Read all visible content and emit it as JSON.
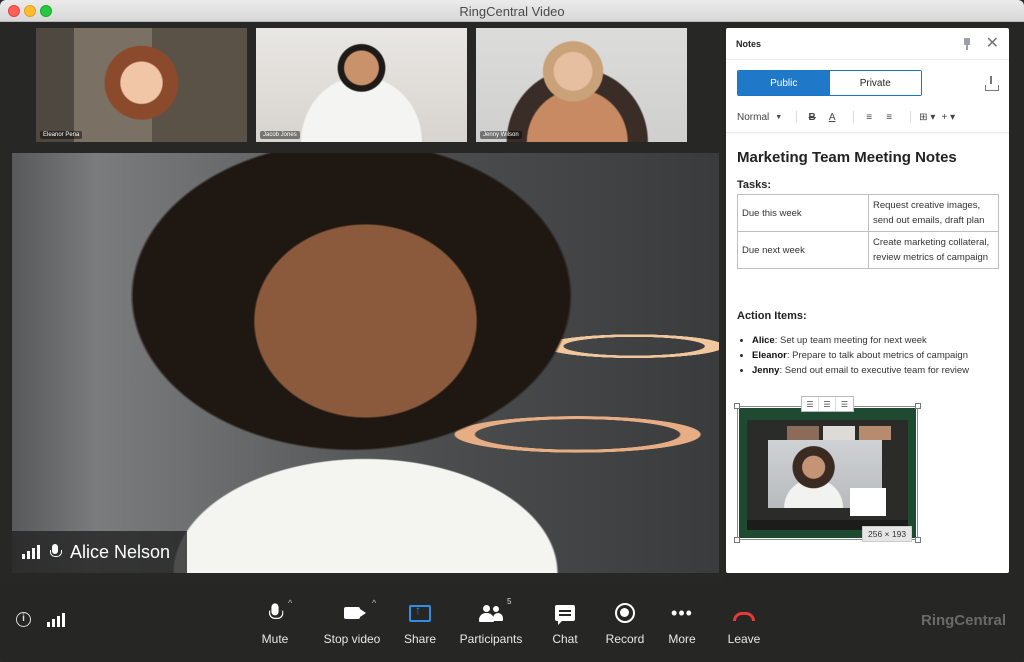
{
  "window": {
    "title": "RingCentral Video"
  },
  "participants": [
    {
      "name": "Eleanor Pena"
    },
    {
      "name": "Jacob Jones"
    },
    {
      "name": "Jenny Wilson"
    }
  ],
  "main_speaker": {
    "name": "Alice Nelson"
  },
  "notes": {
    "panel_title": "Notes",
    "tabs": [
      "Public",
      "Private"
    ],
    "active_tab": "Public",
    "toolbar": {
      "style": "Normal",
      "bold": "B",
      "color": "A",
      "bullets": "≡",
      "align": "≡",
      "table": "⊞ ▾",
      "insert": "+ ▾"
    },
    "doc_title": "Marketing Team Meeting Notes",
    "tasks_heading": "Tasks:",
    "tasks": [
      {
        "due": "Due this week",
        "task": "Request creative images, send out emails, draft plan"
      },
      {
        "due": "Due next week",
        "task": "Create marketing collateral, review metrics of campaign"
      }
    ],
    "action_heading": "Action Items:",
    "actions": [
      {
        "who": "Alice",
        "what": ": Set up team meeting for next week"
      },
      {
        "who": "Eleanor",
        "what": ": Prepare to talk about metrics of campaign"
      },
      {
        "who": "Jenny",
        "what": ": Send out email to executive team for review"
      }
    ],
    "image_size": "256 × 193"
  },
  "controls": {
    "mute": "Mute",
    "stop_video": "Stop video",
    "share": "Share",
    "participants": "Participants",
    "participants_count": "5",
    "chat": "Chat",
    "record": "Record",
    "more": "More",
    "leave": "Leave",
    "info": "i"
  },
  "brand": "RingCentral",
  "colors": {
    "accent": "#1f78c8",
    "leave": "#e5393b",
    "embed_bg": "#1f4a32"
  }
}
